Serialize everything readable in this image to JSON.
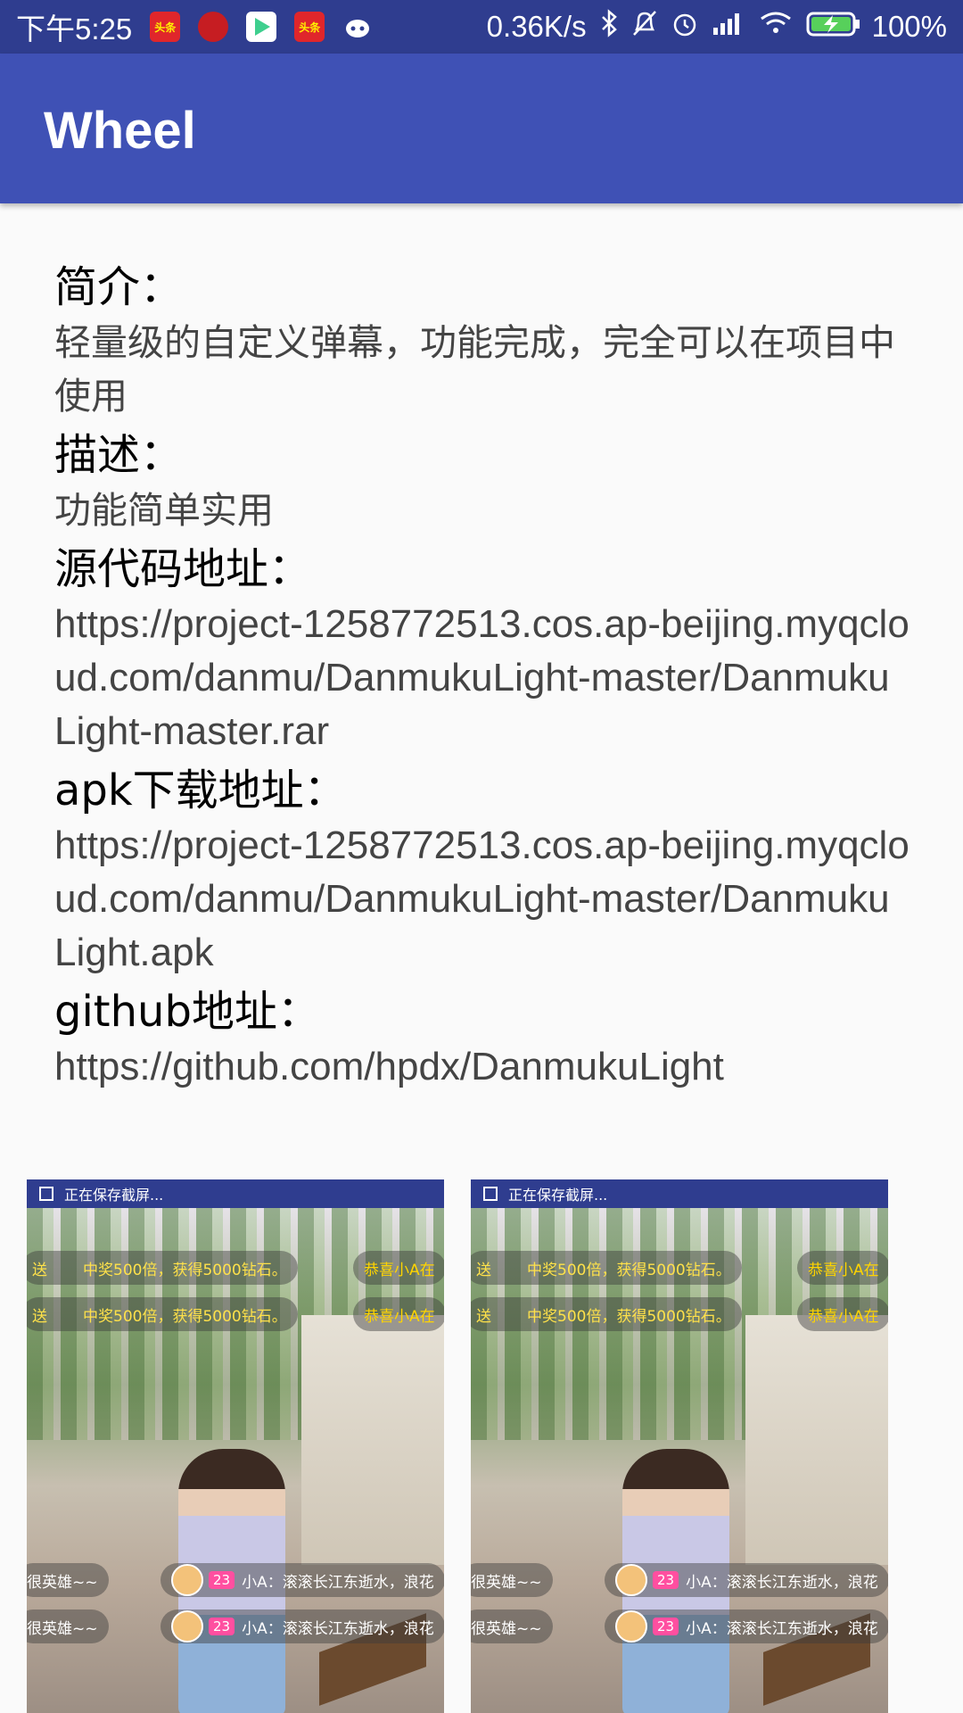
{
  "status_bar": {
    "time": "下午5:25",
    "notification_apps": [
      "头条",
      "weibo",
      "play",
      "头条",
      "robot"
    ],
    "net_speed": "0.36K/s",
    "battery": "100%"
  },
  "app_bar": {
    "title": "Wheel"
  },
  "sections": [
    {
      "heading": "简介：",
      "body": "轻量级的自定义弹幕，功能完成，完全可以在项目中使用"
    },
    {
      "heading": "描述：",
      "body": "功能简单实用"
    },
    {
      "heading": "源代码地址：",
      "body": "https://project-1258772513.cos.ap-beijing.myqcloud.com/danmu/DanmukuLight-master/DanmukuLight-master.rar"
    },
    {
      "heading": "apk下载地址：",
      "body": "https://project-1258772513.cos.ap-beijing.myqcloud.com/danmu/DanmukuLight-master/DanmukuLight.apk"
    },
    {
      "heading": "github地址：",
      "body": "https://github.com/hpdx/DanmukuLight"
    }
  ],
  "screenshots": [
    {
      "status_text": "正在保存截屏...",
      "danmu_top_1": "送",
      "danmu_top_1b": "中奖500倍，获得5000钻石。",
      "danmu_top_right": "恭喜小A在",
      "danmu_bottom_left": "很英雄~~",
      "danmu_bottom_level": "23",
      "danmu_bottom_text": "小A：滚滚长江东逝水，浪花"
    },
    {
      "status_text": "正在保存截屏...",
      "danmu_top_1": "送",
      "danmu_top_1b": "中奖500倍，获得5000钻石。",
      "danmu_top_right": "恭喜小A在",
      "danmu_bottom_left": "很英雄~~",
      "danmu_bottom_level": "23",
      "danmu_bottom_text": "小A：滚滚长江东逝水，浪花"
    }
  ]
}
